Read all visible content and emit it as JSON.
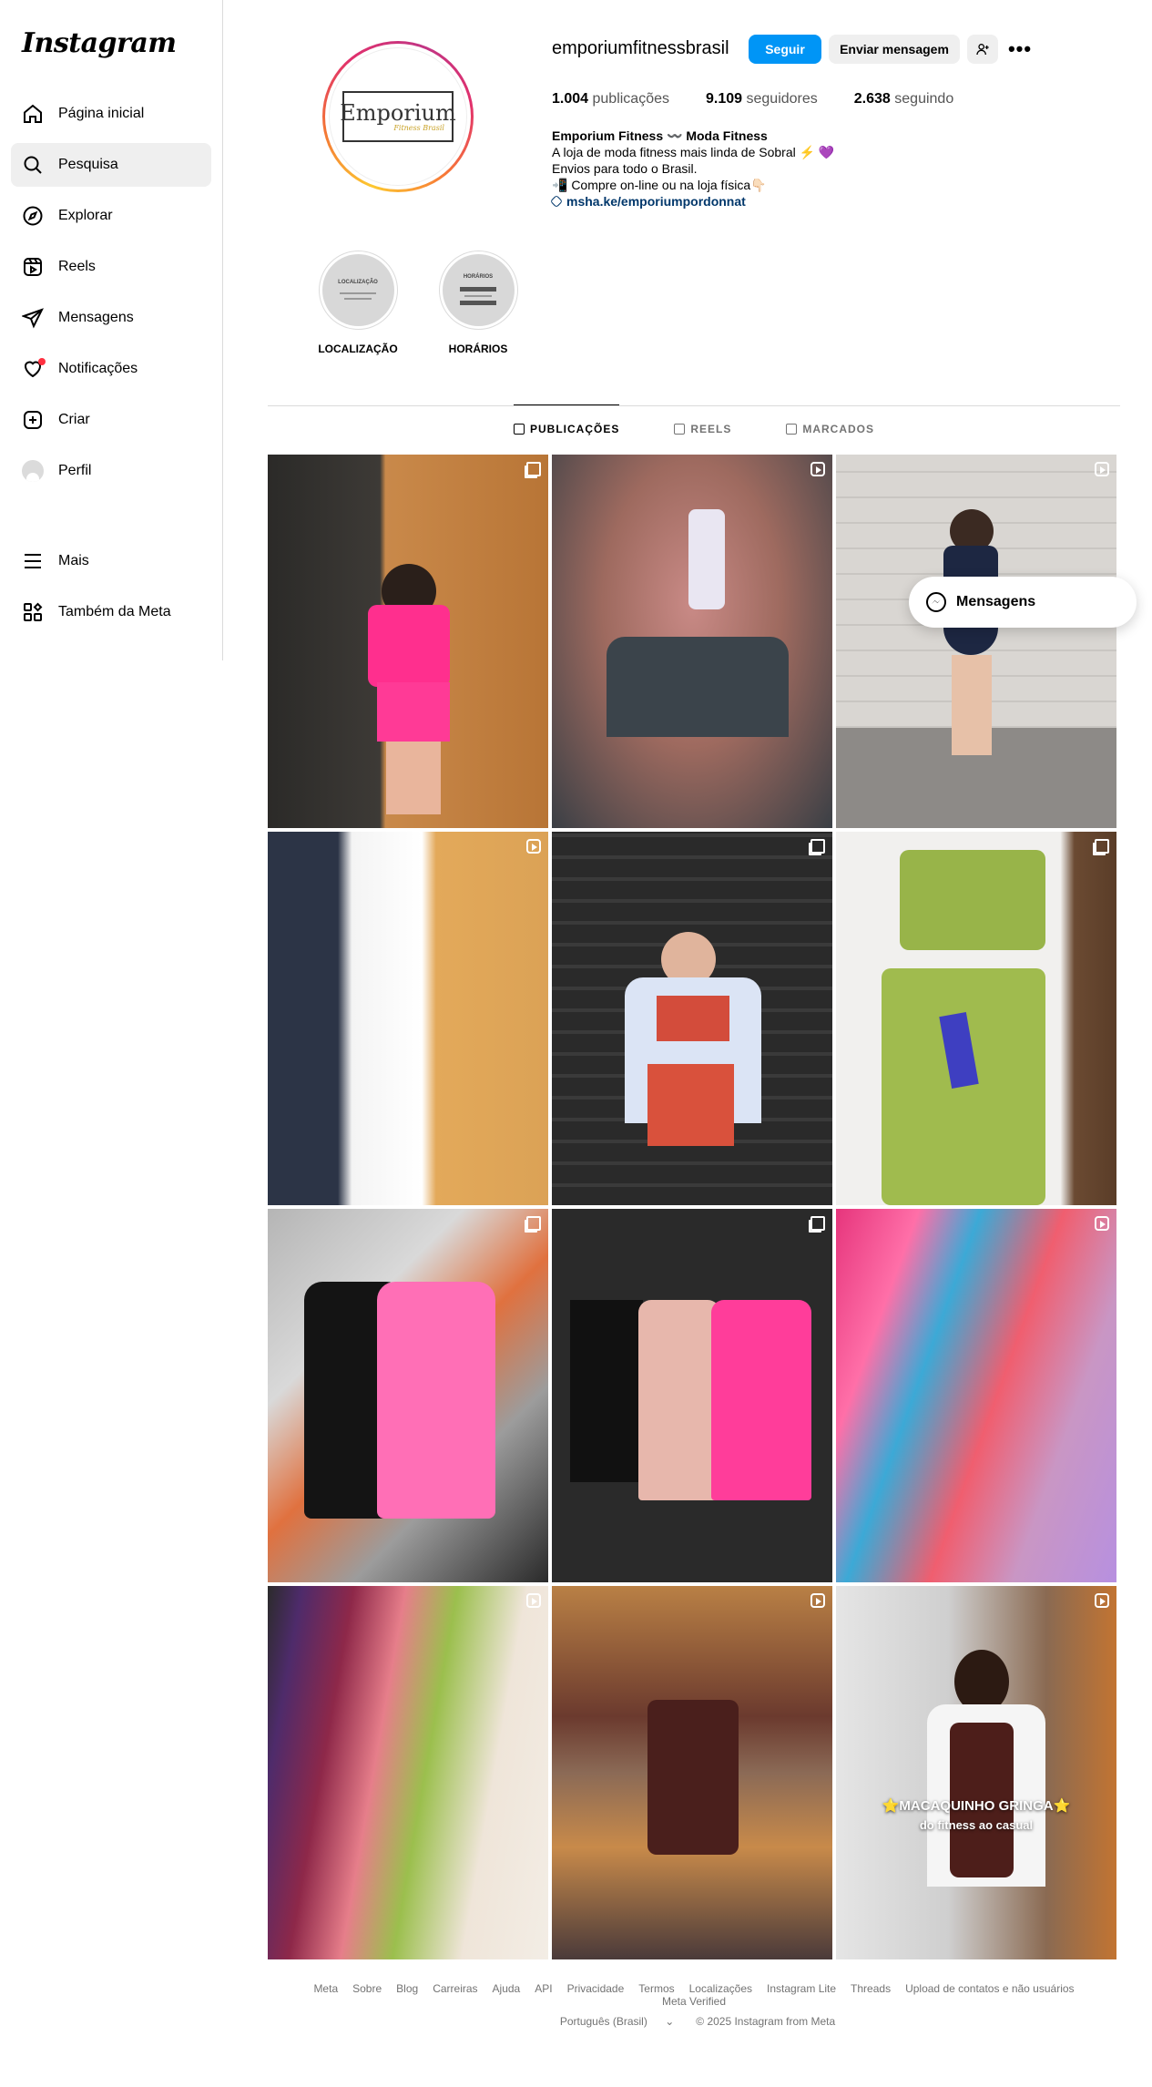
{
  "app": {
    "logo": "Instagram"
  },
  "sidebar": {
    "items": [
      {
        "label": "Página inicial",
        "icon": "home-icon"
      },
      {
        "label": "Pesquisa",
        "icon": "search-icon",
        "active": true
      },
      {
        "label": "Explorar",
        "icon": "compass-icon"
      },
      {
        "label": "Reels",
        "icon": "reels-icon"
      },
      {
        "label": "Mensagens",
        "icon": "send-icon"
      },
      {
        "label": "Notificações",
        "icon": "heart-icon",
        "dot": true
      },
      {
        "label": "Criar",
        "icon": "plus-square-icon"
      },
      {
        "label": "Perfil",
        "icon": "avatar"
      }
    ],
    "lower": [
      {
        "label": "Mais",
        "icon": "menu-icon"
      },
      {
        "label": "Também da Meta",
        "icon": "meta-apps-icon"
      }
    ]
  },
  "profile": {
    "logo_text": "Emporium",
    "logo_subtext": "Fitness Brasil",
    "username": "emporiumfitnessbrasil",
    "follow_label": "Seguir",
    "message_label": "Enviar mensagem",
    "stats": {
      "posts_value": "1.004",
      "posts_label": "publicações",
      "followers_value": "9.109",
      "followers_label": "seguidores",
      "following_value": "2.638",
      "following_label": "seguindo"
    },
    "bio": {
      "name": "Emporium Fitness 〰️ Moda Fitness",
      "line1": "A loja de moda fitness mais linda de Sobral ⚡️ 💜",
      "line2": "Envios para todo o Brasil.",
      "line3": "📲 Compre on-line ou na loja física👇🏻",
      "link": "msha.ke/emporiumpordonnat"
    },
    "highlights": [
      {
        "label": "LOCALIZAÇÃO",
        "inner_title": "LOCALIZAÇÃO"
      },
      {
        "label": "HORÁRIOS",
        "inner_title": "HORÁRIOS"
      }
    ]
  },
  "tabs": [
    {
      "label": "PUBLICAÇÕES",
      "active": true
    },
    {
      "label": "REELS"
    },
    {
      "label": "MARCADOS"
    }
  ],
  "posts": [
    {
      "type": "multi",
      "desc": "pink-set"
    },
    {
      "type": "reel",
      "desc": "gray-top"
    },
    {
      "type": "reel",
      "desc": "navy-dress"
    },
    {
      "type": "reel",
      "desc": "jackets"
    },
    {
      "type": "multi",
      "desc": "red-set"
    },
    {
      "type": "multi",
      "desc": "green-set"
    },
    {
      "type": "multi",
      "desc": "tanks"
    },
    {
      "type": "multi",
      "desc": "tanks2"
    },
    {
      "type": "reel",
      "desc": "colors"
    },
    {
      "type": "reel",
      "desc": "leggings"
    },
    {
      "type": "reel",
      "desc": "brown-set"
    },
    {
      "type": "reel",
      "desc": "macaquinho",
      "overlay1": "⭐MACAQUINHO GRINGA⭐",
      "overlay2": "do fitness ao casual"
    }
  ],
  "floating": {
    "label": "Mensagens"
  },
  "footer": {
    "links": [
      "Meta",
      "Sobre",
      "Blog",
      "Carreiras",
      "Ajuda",
      "API",
      "Privacidade",
      "Termos",
      "Localizações",
      "Instagram Lite",
      "Threads",
      "Upload de contatos e não usuários",
      "Meta Verified"
    ],
    "language": "Português (Brasil)",
    "copyright": "© 2025 Instagram from Meta"
  },
  "colors": {
    "accent": "#0095f6",
    "notification": "#ff3040",
    "link": "#00376b"
  }
}
